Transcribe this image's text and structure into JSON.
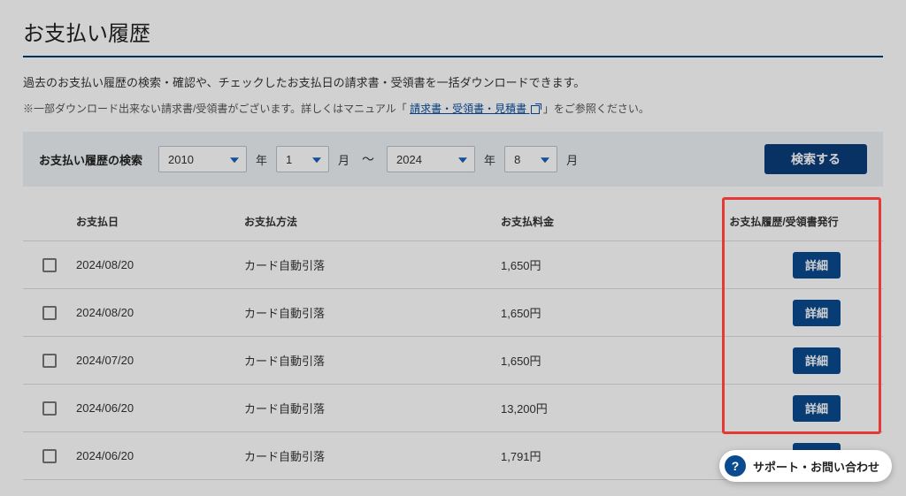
{
  "title": "お支払い履歴",
  "description": "過去のお支払い履歴の検索・確認や、チェックしたお支払日の請求書・受領書を一括ダウンロードできます。",
  "note_prefix": "※一部ダウンロード出来ない請求書/受領書がございます。詳しくはマニュアル「",
  "note_link": "請求書・受領書・見積書",
  "note_suffix": "」をご参照ください。",
  "search": {
    "label": "お支払い履歴の検索",
    "from_year": "2010",
    "from_month": "1",
    "to_year": "2024",
    "to_month": "8",
    "year_unit": "年",
    "month_unit": "月",
    "range_sep": "～",
    "search_btn": "検索する"
  },
  "table": {
    "headers": {
      "date": "お支払日",
      "method": "お支払方法",
      "amount": "お支払料金",
      "action": "お支払履歴/受領書発行"
    },
    "detail_btn": "詳細",
    "rows": [
      {
        "date": "2024/08/20",
        "method": "カード自動引落",
        "amount": "1,650円"
      },
      {
        "date": "2024/08/20",
        "method": "カード自動引落",
        "amount": "1,650円"
      },
      {
        "date": "2024/07/20",
        "method": "カード自動引落",
        "amount": "1,650円"
      },
      {
        "date": "2024/06/20",
        "method": "カード自動引落",
        "amount": "13,200円"
      },
      {
        "date": "2024/06/20",
        "method": "カード自動引落",
        "amount": "1,791円"
      }
    ]
  },
  "support": {
    "icon": "?",
    "label": "サポート・お問い合わせ"
  }
}
